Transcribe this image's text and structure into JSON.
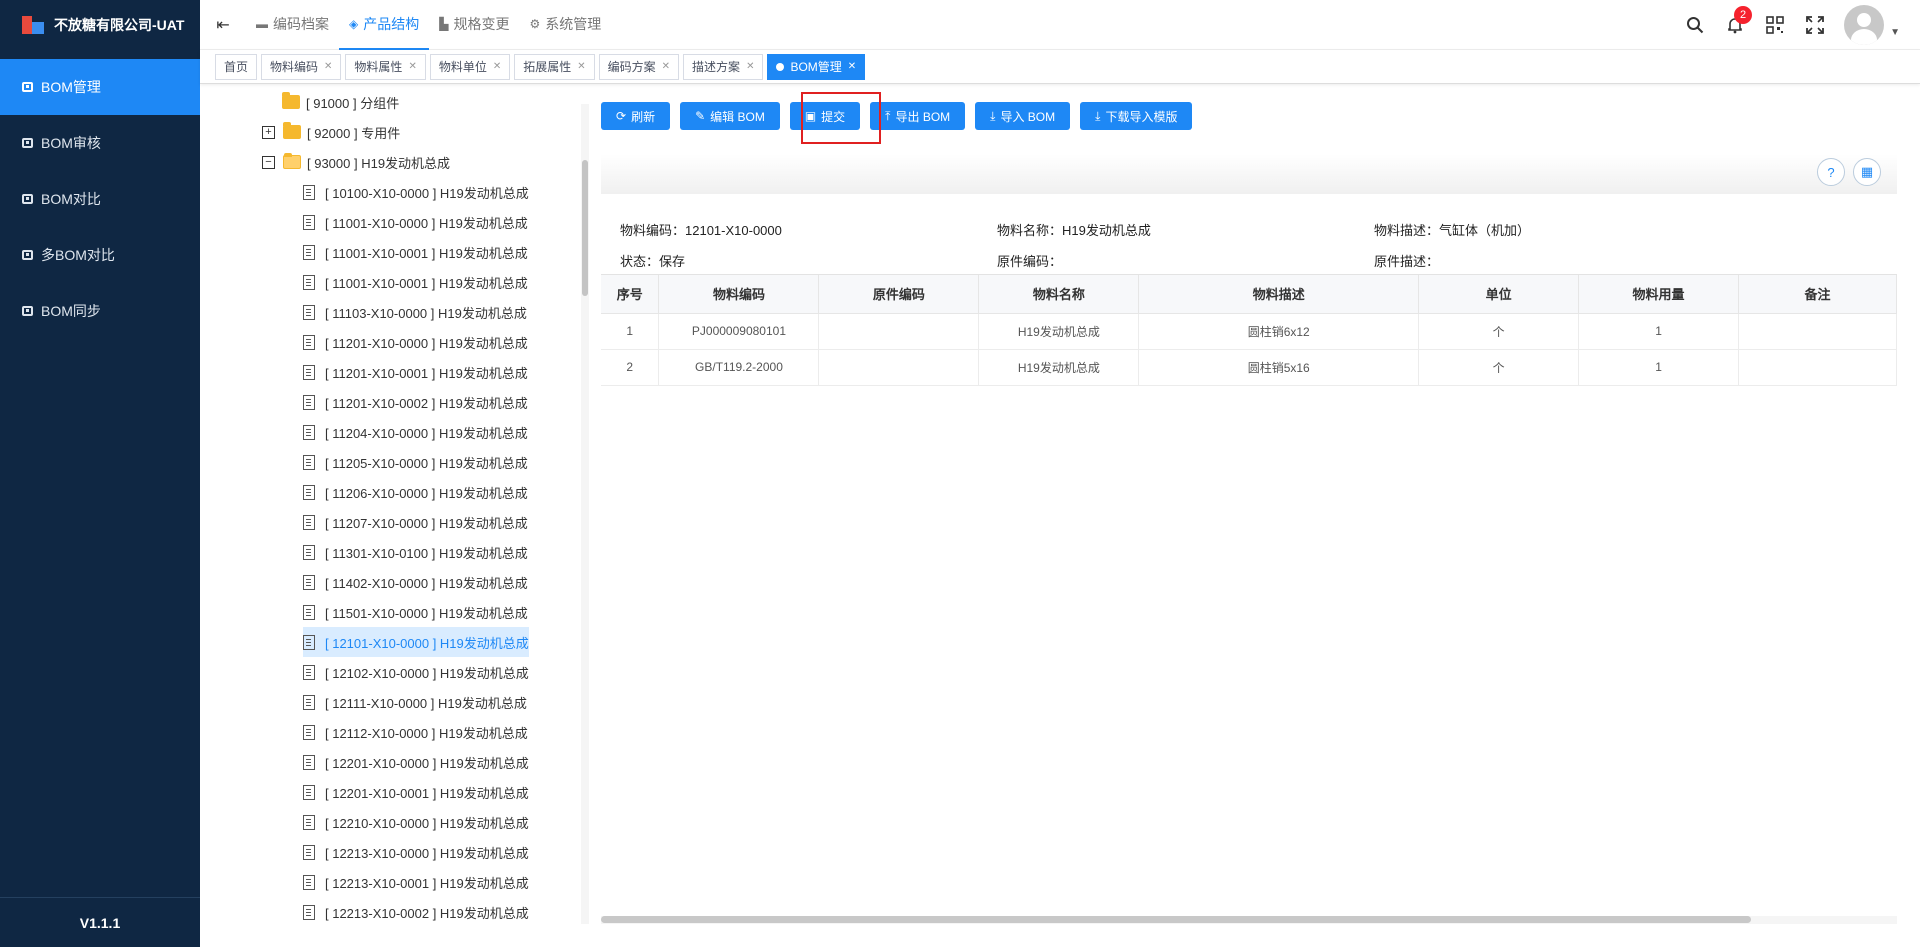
{
  "app": {
    "title": "不放糖有限公司-UAT",
    "version": "V1.1.1"
  },
  "sidebar": {
    "items": [
      {
        "label": "BOM管理",
        "active": true
      },
      {
        "label": "BOM审核",
        "active": false
      },
      {
        "label": "BOM对比",
        "active": false
      },
      {
        "label": "多BOM对比",
        "active": false
      },
      {
        "label": "BOM同步",
        "active": false
      }
    ]
  },
  "top_nav": {
    "items": [
      {
        "label": "编码档案",
        "icon": "folder-icon",
        "active": false
      },
      {
        "label": "产品结构",
        "icon": "layers-icon",
        "active": true
      },
      {
        "label": "规格变更",
        "icon": "chart-icon",
        "active": false
      },
      {
        "label": "系统管理",
        "icon": "gear-icon",
        "active": false
      }
    ]
  },
  "header": {
    "notification_count": "2"
  },
  "tags": [
    {
      "label": "首页",
      "closable": false,
      "active": false
    },
    {
      "label": "物料编码",
      "closable": true,
      "active": false
    },
    {
      "label": "物料属性",
      "closable": true,
      "active": false
    },
    {
      "label": "物料单位",
      "closable": true,
      "active": false
    },
    {
      "label": "拓展属性",
      "closable": true,
      "active": false
    },
    {
      "label": "编码方案",
      "closable": true,
      "active": false
    },
    {
      "label": "描述方案",
      "closable": true,
      "active": false
    },
    {
      "label": "BOM管理",
      "closable": true,
      "active": true
    }
  ],
  "tree": {
    "groups": [
      {
        "label": "[ 91000 ] 分组件",
        "expander": "",
        "open": false
      },
      {
        "label": "[ 92000 ] 专用件",
        "expander": "+",
        "open": false
      },
      {
        "label": "[ 93000 ] H19发动机总成",
        "expander": "−",
        "open": true
      }
    ],
    "leaves": [
      "[ 10100-X10-0000 ] H19发动机总成",
      "[ 11001-X10-0000 ] H19发动机总成",
      "[ 11001-X10-0001 ] H19发动机总成",
      "[ 11001-X10-0001 ] H19发动机总成",
      "[ 11103-X10-0000 ] H19发动机总成",
      "[ 11201-X10-0000 ] H19发动机总成",
      "[ 11201-X10-0001 ] H19发动机总成",
      "[ 11201-X10-0002 ] H19发动机总成",
      "[ 11204-X10-0000 ] H19发动机总成",
      "[ 11205-X10-0000 ] H19发动机总成",
      "[ 11206-X10-0000 ] H19发动机总成",
      "[ 11207-X10-0000 ] H19发动机总成",
      "[ 11301-X10-0100 ] H19发动机总成",
      "[ 11402-X10-0000 ] H19发动机总成",
      "[ 11501-X10-0000 ] H19发动机总成",
      "[ 12101-X10-0000 ] H19发动机总成",
      "[ 12102-X10-0000 ] H19发动机总成",
      "[ 12111-X10-0000 ] H19发动机总成",
      "[ 12112-X10-0000 ] H19发动机总成",
      "[ 12201-X10-0000 ] H19发动机总成",
      "[ 12201-X10-0001 ] H19发动机总成",
      "[ 12210-X10-0000 ] H19发动机总成",
      "[ 12213-X10-0000 ] H19发动机总成",
      "[ 12213-X10-0001 ] H19发动机总成",
      "[ 12213-X10-0002 ] H19发动机总成"
    ],
    "selected_index": 15
  },
  "toolbar": {
    "buttons": [
      {
        "label": "刷新",
        "icon": "refresh-icon"
      },
      {
        "label": "编辑 BOM",
        "icon": "edit-icon"
      },
      {
        "label": "提交",
        "icon": "save-icon"
      },
      {
        "label": "导出 BOM",
        "icon": "upload-icon"
      },
      {
        "label": "导入 BOM",
        "icon": "download-icon"
      },
      {
        "label": "下载导入模版",
        "icon": "download-icon"
      }
    ]
  },
  "info": {
    "material_code_label": "物料编码：",
    "material_code": "12101-X10-0000",
    "material_name_label": "物料名称：",
    "material_name": "H19发动机总成",
    "material_desc_label": "物料描述：",
    "material_desc": "气缸体（机加）",
    "status_label": "状态：",
    "status": "保存",
    "orig_code_label": "原件编码：",
    "orig_code": "",
    "orig_desc_label": "原件描述：",
    "orig_desc": ""
  },
  "table": {
    "columns": [
      "序号",
      "物料编码",
      "原件编码",
      "物料名称",
      "物料描述",
      "单位",
      "物料用量",
      "备注"
    ],
    "rows": [
      [
        "1",
        "PJ000009080101",
        "",
        "H19发动机总成",
        "圆柱销6x12",
        "个",
        "1",
        ""
      ],
      [
        "2",
        "GB/T119.2-2000",
        "",
        "H19发动机总成",
        "圆柱销5x16",
        "个",
        "1",
        ""
      ]
    ]
  },
  "colors": {
    "primary": "#1e88f5",
    "sidebar_bg": "#0f2743",
    "highlight_border": "#e02020"
  }
}
